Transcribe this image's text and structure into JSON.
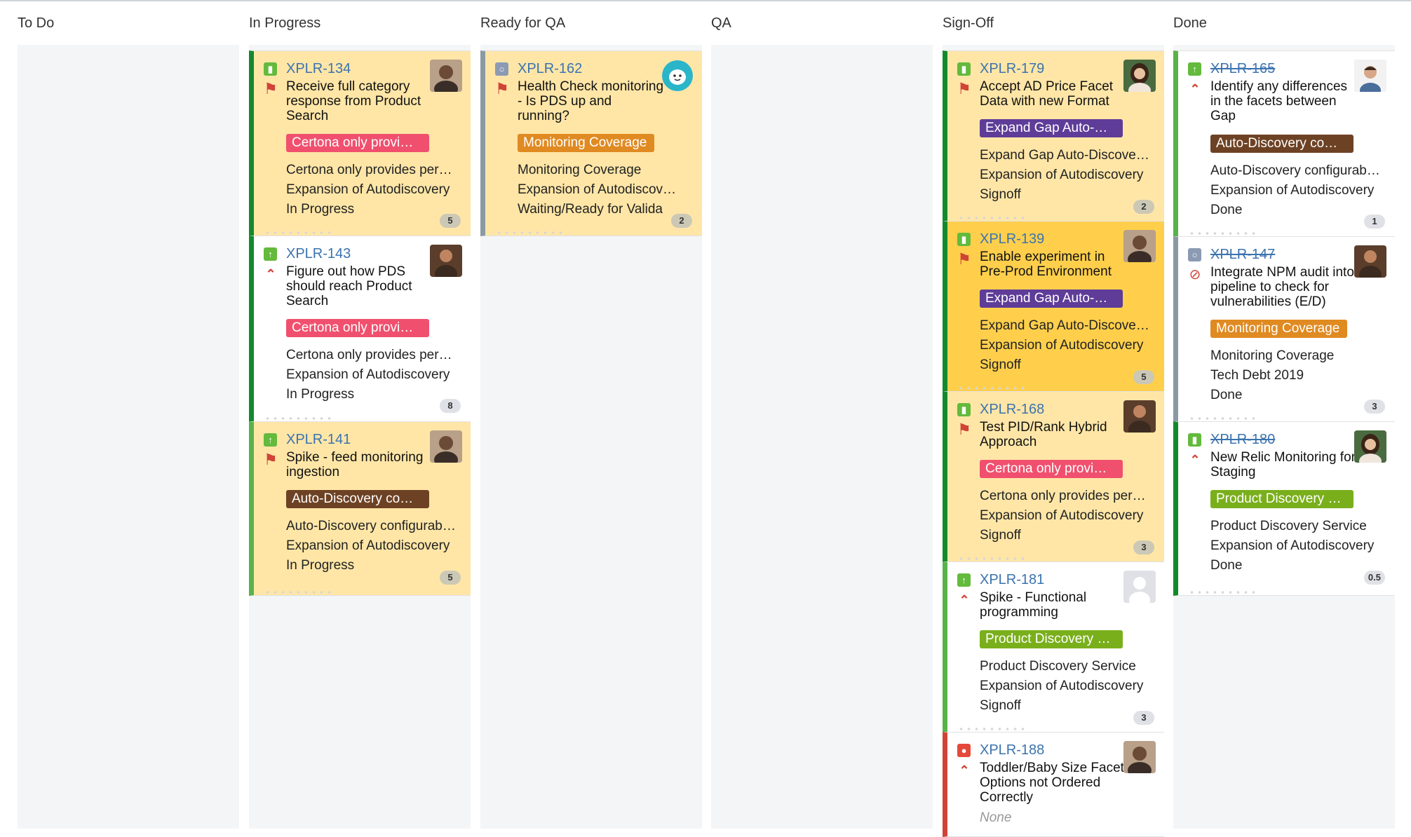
{
  "columns": [
    {
      "name": "To Do"
    },
    {
      "name": "In Progress"
    },
    {
      "name": "Ready for QA"
    },
    {
      "name": "QA"
    },
    {
      "name": "Sign-Off"
    },
    {
      "name": "Done"
    }
  ],
  "colors": {
    "flagged_card": "#ffe6a7",
    "selected_card": "#ffcf4c",
    "link_blue": "#3b73af",
    "epic_red": "#f0506e",
    "epic_purple": "#5e3c98",
    "epic_brown": "#6d4224",
    "epic_orange": "#e08a22",
    "epic_green": "#7aaf1c"
  },
  "cards": {
    "xplr134": {
      "key": "XPLR-134",
      "summary": "Receive full category response from Product Search",
      "epic": "Certona only provi…",
      "epic_full": "Certona only provides per…",
      "epic_name": "Expansion of Autodiscovery",
      "status": "In Progress",
      "estimate": "5",
      "type_icon": "story-icon",
      "priority_icon": "blocker-flag-icon"
    },
    "xplr143": {
      "key": "XPLR-143",
      "summary": "Figure out how PDS should reach Product Search",
      "epic": "Certona only provi…",
      "epic_full": "Certona only provides per…",
      "epic_name": "Expansion of Autodiscovery",
      "status": "In Progress",
      "estimate": "8",
      "type_icon": "improvement-icon",
      "priority_icon": "high-priority-icon"
    },
    "xplr141": {
      "key": "XPLR-141",
      "summary": "Spike - feed monitoring ingestion",
      "epic": "Auto-Discovery co…",
      "epic_full": "Auto-Discovery configurab…",
      "epic_name": "Expansion of Autodiscovery",
      "status": "In Progress",
      "estimate": "5",
      "type_icon": "improvement-icon",
      "priority_icon": "blocker-flag-icon"
    },
    "xplr162": {
      "key": "XPLR-162",
      "summary": "Health Check monitoring - Is PDS up and running?",
      "epic": "Monitoring Coverage",
      "epic_full": "Monitoring Coverage",
      "epic_name": "Expansion of Autodiscovery",
      "status": "Waiting/Ready for Valida",
      "estimate": "2",
      "type_icon": "task-icon",
      "priority_icon": "blocker-flag-icon"
    },
    "xplr179": {
      "key": "XPLR-179",
      "summary": "Accept AD Price Facet Data with new Format",
      "epic": "Expand Gap Auto-…",
      "epic_full": "Expand Gap Auto-Discove…",
      "epic_name": "Expansion of Autodiscovery",
      "status": "Signoff",
      "estimate": "2",
      "type_icon": "story-icon",
      "priority_icon": "blocker-flag-icon"
    },
    "xplr139": {
      "key": "XPLR-139",
      "summary": "Enable experiment in Pre-Prod Environment",
      "epic": "Expand Gap Auto-…",
      "epic_full": "Expand Gap Auto-Discove…",
      "epic_name": "Expansion of Autodiscovery",
      "status": "Signoff",
      "estimate": "5",
      "type_icon": "story-icon",
      "priority_icon": "blocker-flag-icon"
    },
    "xplr168": {
      "key": "XPLR-168",
      "summary": "Test PID/Rank Hybrid Approach",
      "epic": "Certona only provi…",
      "epic_full": "Certona only provides per…",
      "epic_name": "Expansion of Autodiscovery",
      "status": "Signoff",
      "estimate": "3",
      "type_icon": "story-icon",
      "priority_icon": "blocker-flag-icon"
    },
    "xplr181": {
      "key": "XPLR-181",
      "summary": "Spike - Functional programming",
      "epic": "Product Discovery …",
      "epic_full": "Product Discovery Service",
      "epic_name": "Expansion of Autodiscovery",
      "status": "Signoff",
      "estimate": "3",
      "type_icon": "improvement-icon",
      "priority_icon": "high-priority-icon"
    },
    "xplr188": {
      "key": "XPLR-188",
      "summary": "Toddler/Baby Size Facet Options not Ordered Correctly",
      "status_none": "None",
      "type_icon": "bug-icon",
      "priority_icon": "high-priority-icon"
    },
    "xplr165": {
      "key": "XPLR-165",
      "summary": "Identify any differences in the facets between Gap",
      "epic": "Auto-Discovery co…",
      "epic_full": "Auto-Discovery configurab…",
      "epic_name": "Expansion of Autodiscovery",
      "status": "Done",
      "estimate": "1",
      "type_icon": "improvement-icon",
      "priority_icon": "high-priority-icon"
    },
    "xplr147": {
      "key": "XPLR-147",
      "summary": "Integrate NPM audit into pipeline to check for vulnerabilities (E/D)",
      "epic": "Monitoring Coverage",
      "epic_full": "Monitoring Coverage",
      "epic_name": "Tech Debt 2019",
      "status": "Done",
      "estimate": "3",
      "type_icon": "task-icon",
      "priority_icon": "blocked-icon"
    },
    "xplr180": {
      "key": "XPLR-180",
      "summary": "New Relic Monitoring for Staging",
      "epic": "Product Discovery …",
      "epic_full": "Product Discovery Service",
      "epic_name": "Expansion of Autodiscovery",
      "status": "Done",
      "estimate": "0.5",
      "type_icon": "story-icon",
      "priority_icon": "high-priority-icon"
    }
  }
}
